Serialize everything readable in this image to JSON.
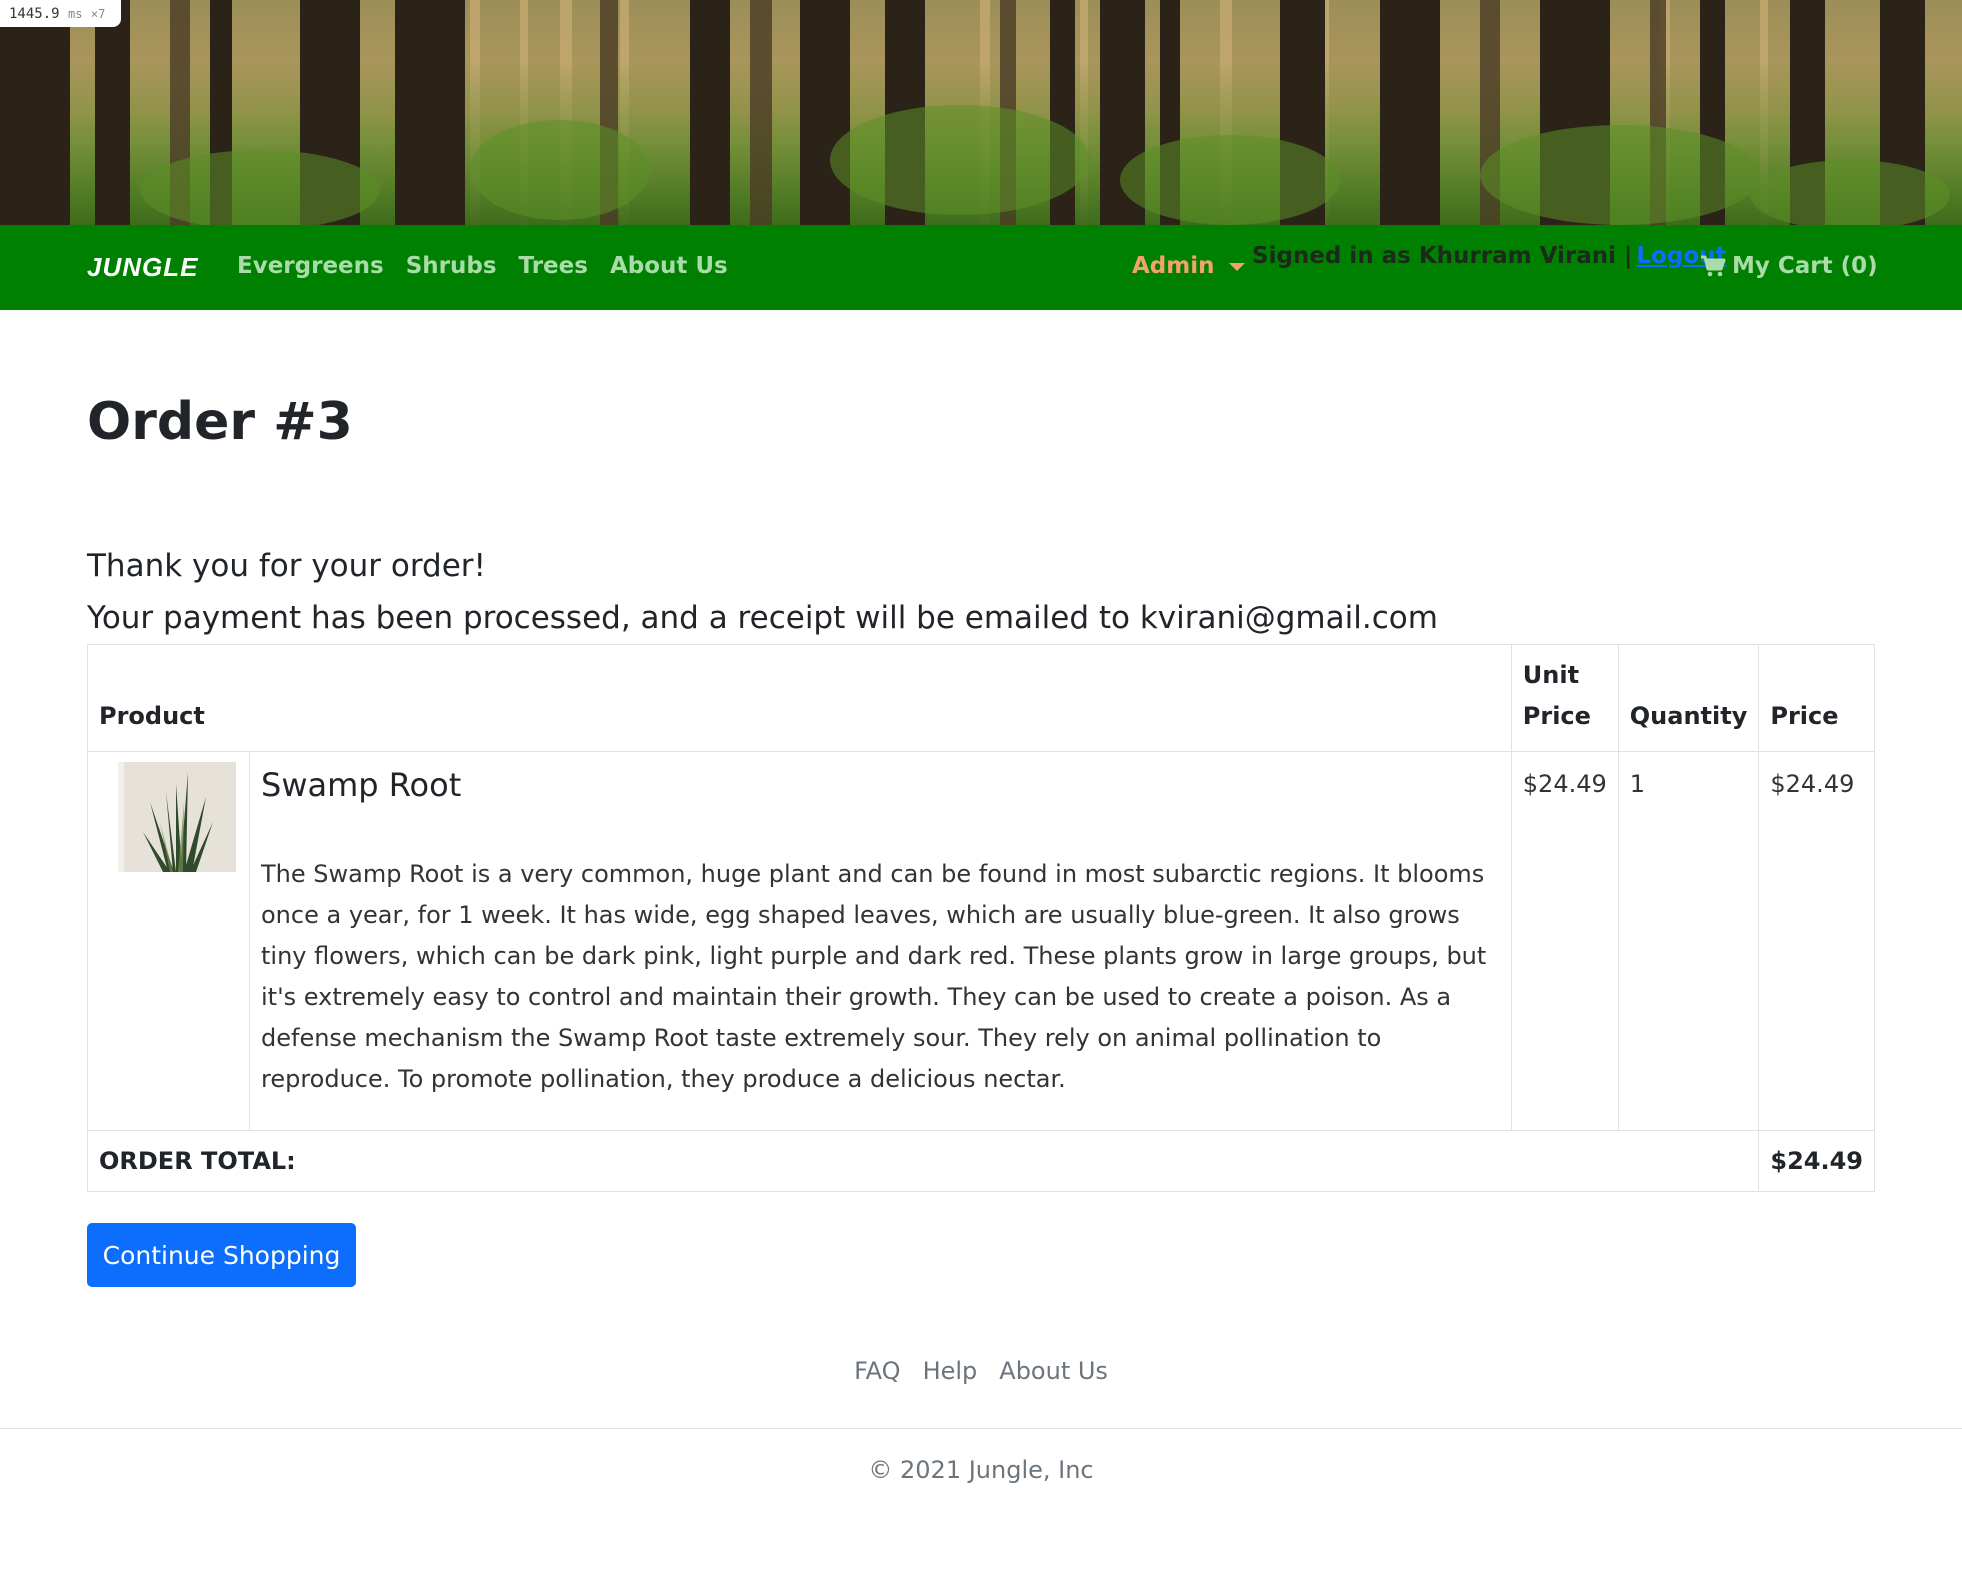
{
  "perf_badge": {
    "value": "1445.9",
    "unit": "ms",
    "mult": "×7"
  },
  "navbar": {
    "brand": "JUNGLE",
    "links": [
      "Evergreens",
      "Shrubs",
      "Trees",
      "About Us"
    ],
    "admin_label": "Admin",
    "signed_in_text": "Signed in as Khurram Virani |",
    "logout_label": "Logout",
    "cart_label": "My Cart (0)"
  },
  "order": {
    "title": "Order #3",
    "thanks_line1": "Thank you for your order!",
    "thanks_line2": "Your payment has been processed, and a receipt will be emailed to kvirani@gmail.com"
  },
  "table": {
    "headers": {
      "product": "Product",
      "unit_price_1": "Unit",
      "unit_price_2": "Price",
      "quantity": "Quantity",
      "price": "Price"
    },
    "items": [
      {
        "name": "Swamp Root",
        "description": "The Swamp Root is a very common, huge plant and can be found in most subarctic regions. It blooms once a year, for 1 week. It has wide, egg shaped leaves, which are usually blue-green. It also grows tiny flowers, which can be dark pink, light purple and dark red. These plants grow in large groups, but it's extremely easy to control and maintain their growth. They can be used to create a poison. As a defense mechanism the Swamp Root taste extremely sour. They rely on animal pollination to reproduce. To promote pollination, they produce a delicious nectar.",
        "unit_price": "$24.49",
        "quantity": "1",
        "price": "$24.49"
      }
    ],
    "total_label": "ORDER TOTAL:",
    "total_value": "$24.49"
  },
  "continue_button": "Continue Shopping",
  "footer": {
    "links": [
      "FAQ",
      "Help",
      "About Us"
    ],
    "copyright": "© 2021 Jungle, Inc"
  },
  "colors": {
    "navbar": "#008000",
    "primary_button": "#0d6efd",
    "admin": "#f4a26b",
    "nav_link": "#a9dca9"
  }
}
